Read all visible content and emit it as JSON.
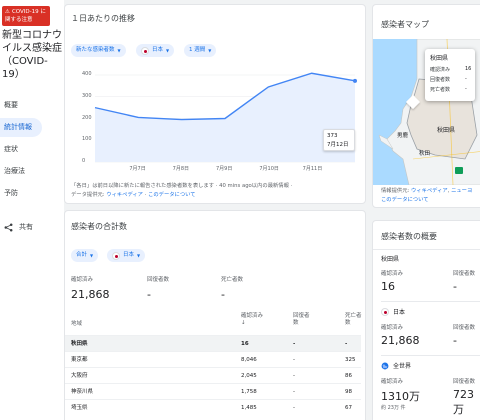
{
  "sidebar": {
    "alert": "COVID-19 に関する注意",
    "title": "新型コロナウイルス感染症（COVID-19）",
    "nav": [
      {
        "label": "概要",
        "active": false
      },
      {
        "label": "統計情報",
        "active": true
      },
      {
        "label": "症状",
        "active": false
      },
      {
        "label": "治療法",
        "active": false
      },
      {
        "label": "予防",
        "active": false
      }
    ],
    "share": "共有"
  },
  "trend_card": {
    "title": "１日あたりの推移",
    "chip_metric": "新たな感染者数",
    "chip_region": "日本",
    "chip_period": "1 週間",
    "tooltip_value": "373",
    "tooltip_date": "7月12日",
    "footnote_line1": "「各日」は前日以降に新たに報告された感染者数を表します",
    "footnote_time": "40 mins ago以内の最新情報",
    "footnote_source_label": "データ提供元:",
    "footnote_source": "ウィキペディア",
    "footnote_about": "このデータについて"
  },
  "chart_data": {
    "type": "area",
    "x": [
      "7月6日",
      "7月7日",
      "7月8日",
      "7月9日",
      "7月10日",
      "7月11日",
      "7月12日"
    ],
    "xticks": [
      "7月7日",
      "7月8日",
      "7月9日",
      "7月10日",
      "7月11日"
    ],
    "values": [
      250,
      205,
      195,
      200,
      345,
      408,
      373
    ],
    "yticks": [
      "400",
      "300",
      "200",
      "100",
      "0"
    ],
    "ylim": [
      0,
      400
    ],
    "grid": true,
    "color": "#4285f4",
    "fill": "#e8f0fe"
  },
  "totals_card": {
    "title": "感染者の合計数",
    "chip_scope": "合計",
    "chip_region": "日本",
    "stats": [
      {
        "label": "確認済み",
        "value": "21,868"
      },
      {
        "label": "回復者数",
        "value": "-"
      },
      {
        "label": "死亡者数",
        "value": "-"
      }
    ],
    "table_headers": [
      "地域",
      "確認済み ↓",
      "回復者数",
      "死亡者数"
    ],
    "rows": [
      {
        "region": "秋田県",
        "confirmed": "16",
        "recovered": "-",
        "deaths": "-",
        "selected": true
      },
      {
        "region": "東京都",
        "confirmed": "8,046",
        "recovered": "-",
        "deaths": "325",
        "selected": false
      },
      {
        "region": "大阪府",
        "confirmed": "2,045",
        "recovered": "-",
        "deaths": "86",
        "selected": false
      },
      {
        "region": "神奈川県",
        "confirmed": "1,758",
        "recovered": "-",
        "deaths": "98",
        "selected": false
      },
      {
        "region": "埼玉県",
        "confirmed": "1,485",
        "recovered": "-",
        "deaths": "67",
        "selected": false
      }
    ]
  },
  "map_card": {
    "title": "感染者マップ",
    "tooltip_title": "秋田県",
    "tooltip_rows": [
      {
        "label": "確認済み",
        "value": "16"
      },
      {
        "label": "回復者数",
        "value": "-"
      },
      {
        "label": "死亡者数",
        "value": "-"
      }
    ],
    "labels": {
      "pref": "秋田県",
      "city": "秋田",
      "oga": "男鹿"
    },
    "source_label": "情報提供元:",
    "source_wiki": "ウィキペディア",
    "source_other": "ニューヨ",
    "about": "このデータについて"
  },
  "overview_card": {
    "title": "感染者数の概要",
    "sections": [
      {
        "name": "秋田県",
        "confirmed": "16",
        "recovered": "-"
      },
      {
        "name": "日本",
        "confirmed": "21,868",
        "recovered": "-"
      },
      {
        "name": "全世界",
        "confirmed": "1310万",
        "recovered": "723万",
        "note": "約 23万 件"
      }
    ],
    "label_confirmed": "確認済み",
    "label_recovered": "回復者数"
  }
}
